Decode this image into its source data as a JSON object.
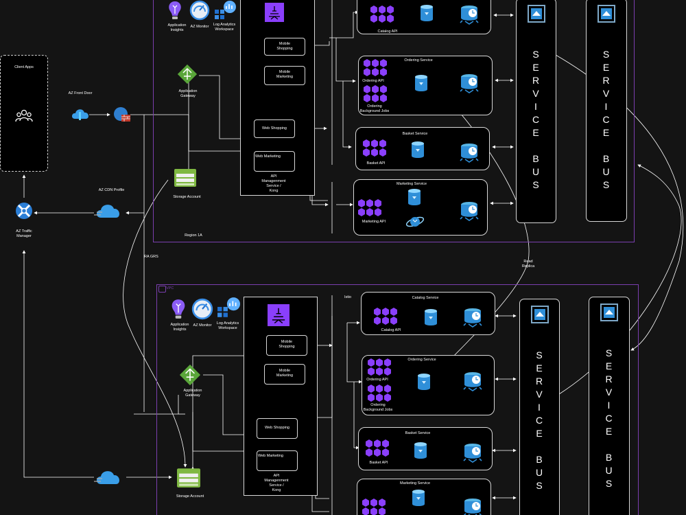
{
  "left": {
    "client_apps": "Client Apps",
    "front_door": "AZ Front Door",
    "cdn_profile": "AZ CDN Profile",
    "traffic_manager": "AZ Traffic\nManager",
    "ra_grs": "RA GRS",
    "read_replica": "Read\nReplica"
  },
  "region_a": {
    "label": "Region 1A",
    "app_insights": "Application\nInsights",
    "az_monitor": "AZ Monitor",
    "log_analytics": "Log Analytics\nWorkspace",
    "app_gateway": "Application\nGateway",
    "storage_account": "Storage Account",
    "apim": "API\nManagenment\nService /\nKong",
    "mobile_shopping": "Mobile\nShopping",
    "mobile_marketing": "Mobile\nMarketing",
    "web_shopping": "Web Shopping",
    "web_marketing": "Web Marketing",
    "catalog_api": "Catalog API",
    "ordering_service": "Ordering Service",
    "ordering_api": "Ordering API",
    "ordering_bg": "Ordering\nBackground Jobs",
    "basket_service": "Basket Service",
    "basket_api": "Basket API",
    "marketing_service": "Marketing Service",
    "marketing_api": "Marketing API",
    "service_bus_1": "S\nE\nR\nV\nI\nC\nE\n\nB\nU\nS",
    "service_bus_2": "S\nE\nR\nV\nI\nC\nE\n\nB\nU\nS"
  },
  "region_b": {
    "vpc_label": "VPC",
    "istio": "Istio",
    "app_insights": "Application\nInsights",
    "az_monitor": "AZ Monitor",
    "log_analytics": "Log Analytics\nWorkspace",
    "app_gateway": "Application\nGateway",
    "storage_account": "Storage Account",
    "apim": "API\nManagenment\nService /\nKong",
    "mobile_shopping": "Mobile\nShopping",
    "mobile_marketing": "Mobile\nMarketing",
    "web_shopping": "Web Shopping",
    "web_marketing": "Web Marketing",
    "catalog_service": "Catalog Service",
    "catalog_api": "Catalog API",
    "ordering_service": "Ordering Service",
    "ordering_api": "Ordering API",
    "ordering_bg": "Ordering\nBackground Jobs",
    "basket_service": "Basket Service",
    "basket_api": "Basket API",
    "marketing_service": "Marketing Service",
    "service_bus_1": "S\nE\nR\nV\nI\nC\nE\n\nB\nU\nS",
    "service_bus_2": "S\nE\nR\nV\nI\nC\nE\n\nB\nU\nS"
  },
  "colors": {
    "background": "#141414",
    "pod_purple": "#8a3ffc",
    "region_border": "#7b3fb0",
    "sql_blue": "#2f8fd8",
    "db_teal": "#58b6e6"
  }
}
